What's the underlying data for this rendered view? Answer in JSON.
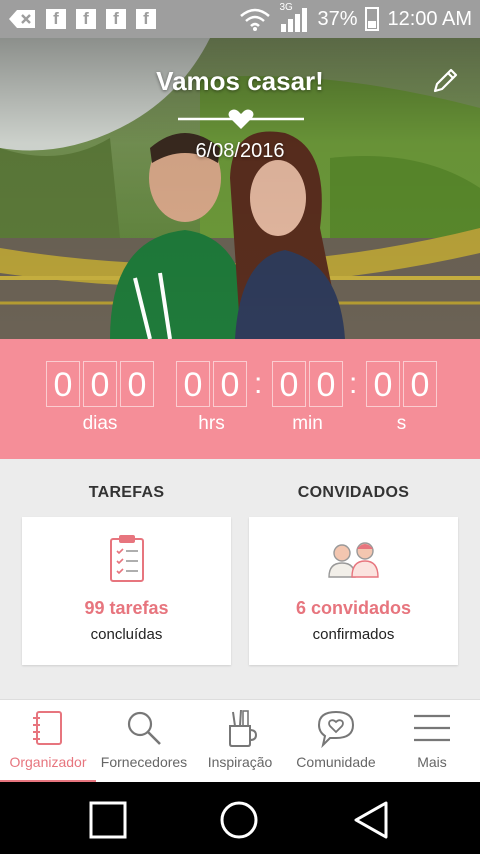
{
  "status_bar": {
    "signal_type": "3G",
    "battery": "37%",
    "time": "12:00 AM",
    "icons": [
      "back-arrow-icon",
      "facebook-icon",
      "facebook-icon",
      "facebook-icon",
      "facebook-icon",
      "wifi-icon",
      "signal-icon",
      "battery-icon"
    ]
  },
  "hero": {
    "title": "Vamos casar!",
    "date": "6/08/2016",
    "divider_icon": "heart-icon",
    "edit_icon": "pencil-icon"
  },
  "countdown": {
    "days": [
      "0",
      "0",
      "0"
    ],
    "hours": [
      "0",
      "0"
    ],
    "minutes": [
      "0",
      "0"
    ],
    "seconds": [
      "0",
      "0"
    ],
    "labels": {
      "days": "dias",
      "hours": "hrs",
      "minutes": "min",
      "seconds": "s"
    }
  },
  "tarefas": {
    "title": "TAREFAS",
    "count_label": "99 tarefas",
    "status": "concluídas",
    "icon": "clipboard-checklist-icon"
  },
  "convidados": {
    "title": "CONVIDADOS",
    "count_label": "6 convidados",
    "status": "confirmados",
    "icon": "guests-couple-icon"
  },
  "bottom_nav": {
    "items": [
      {
        "label": "Organizador",
        "icon": "notebook-icon",
        "active": true
      },
      {
        "label": "Fornecedores",
        "icon": "search-icon",
        "active": false
      },
      {
        "label": "Inspiração",
        "icon": "pencil-cup-icon",
        "active": false
      },
      {
        "label": "Comunidade",
        "icon": "chat-heart-icon",
        "active": false
      },
      {
        "label": "Mais",
        "icon": "menu-icon",
        "active": false
      }
    ]
  },
  "colors": {
    "accent": "#e7757e",
    "countdown_bg": "#f58e98",
    "background": "#ececec",
    "statusbar": "#9e9e9e"
  }
}
